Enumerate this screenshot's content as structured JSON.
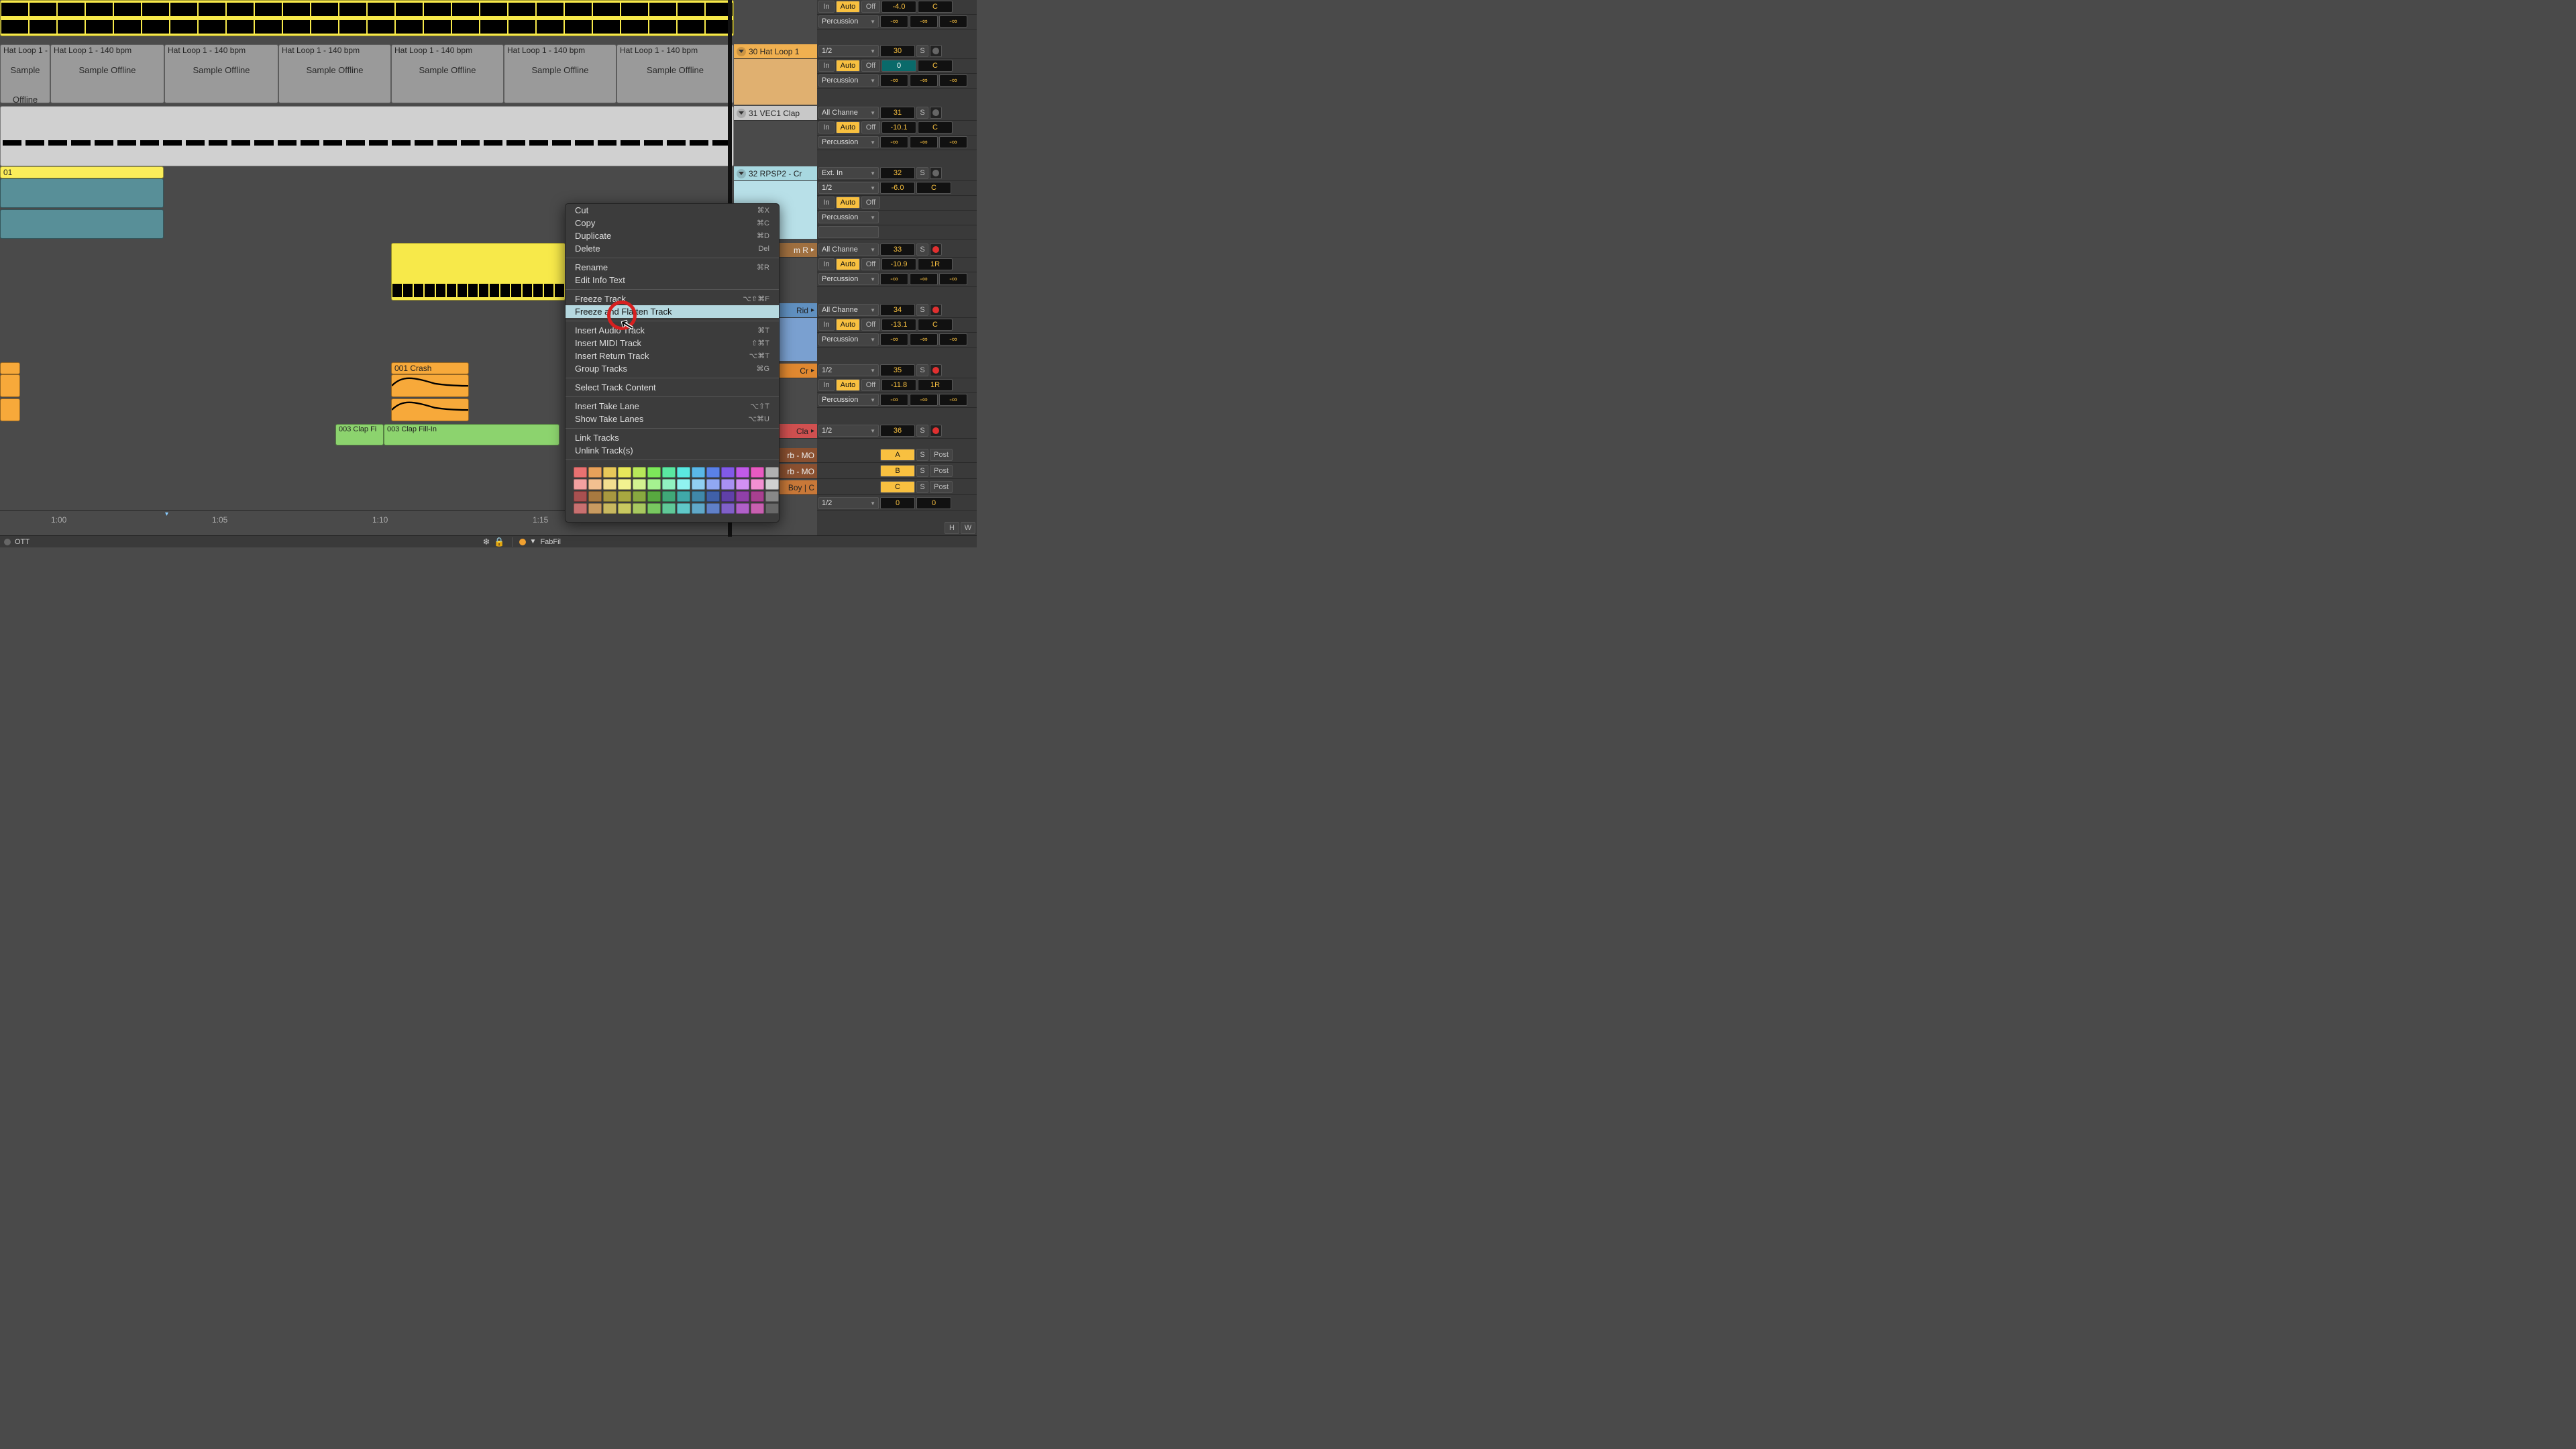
{
  "clips": {
    "hat_loop_label": "Hat Loop 1 - 140 bpm",
    "sample_offline": "Sample Offline",
    "clip_01": "01",
    "crash_001": "001 Crash",
    "clap_fillin_a": "003 Clap Fi",
    "clap_fillin_b": "003 Clap Fill-In"
  },
  "ruler": {
    "t100": "1:00",
    "t105": "1:05",
    "t110": "1:10",
    "t115": "1:15"
  },
  "status": {
    "ott": "OTT",
    "fabfil": "FabFil"
  },
  "tracks": {
    "t30": "30 Hat Loop 1",
    "t31": "31 VEC1 Clap",
    "t32": "32 RPSP2 - Cr",
    "t33_partial": "m R",
    "t34_partial": "Rid",
    "t35_partial": "Cr",
    "t36_partial": "Cla",
    "rb_mo_1": "rb - MO",
    "rb_mo_2": "rb - MO",
    "boy_c": "Boy | C"
  },
  "mixer": {
    "labels": {
      "in": "In",
      "auto": "Auto",
      "off": "Off",
      "percussion": "Percussion",
      "half": "1/2",
      "ext_in": "Ext. In",
      "all_ch": "All Channe",
      "s": "S",
      "post": "Post",
      "h": "H",
      "w": "W"
    },
    "row_a": {
      "vol": "-4.0",
      "pan": "C",
      "inf1": "-∞",
      "inf2": "-∞",
      "inf3": "-∞"
    },
    "row_30": {
      "trk": "30",
      "vol": "0",
      "pan": "C",
      "inf1": "-∞",
      "inf2": "-∞",
      "inf3": "-∞"
    },
    "row_31": {
      "trk": "31",
      "vol": "-10.1",
      "pan": "C",
      "inf1": "-∞",
      "inf2": "-∞",
      "inf3": "-∞"
    },
    "row_32": {
      "trk": "32",
      "vol": "-6.0",
      "pan": "C"
    },
    "row_33": {
      "trk": "33",
      "vol": "-10.9",
      "pan": "1R",
      "inf1": "-∞",
      "inf2": "-∞",
      "inf3": "-∞"
    },
    "row_34": {
      "trk": "34",
      "vol": "-13.1",
      "pan": "C",
      "inf1": "-∞",
      "inf2": "-∞",
      "inf3": "-∞"
    },
    "row_35": {
      "trk": "35",
      "vol": "-11.8",
      "pan": "1R",
      "inf1": "-∞",
      "inf2": "-∞",
      "inf3": "-∞"
    },
    "row_36": {
      "trk": "36"
    },
    "send_a": "A",
    "send_b": "B",
    "send_c": "C",
    "zero": "0"
  },
  "menu": {
    "cut": "Cut",
    "cut_k": "⌘X",
    "copy": "Copy",
    "copy_k": "⌘C",
    "dup": "Duplicate",
    "dup_k": "⌘D",
    "del": "Delete",
    "del_k": "Del",
    "rename": "Rename",
    "rename_k": "⌘R",
    "edit_info": "Edit Info Text",
    "freeze": "Freeze Track",
    "freeze_k": "⌥⇧⌘F",
    "freeze_flat": "Freeze and Flatten Track",
    "ins_audio": "Insert Audio Track",
    "ins_audio_k": "⌘T",
    "ins_midi": "Insert MIDI Track",
    "ins_midi_k": "⇧⌘T",
    "ins_return": "Insert Return Track",
    "ins_return_k": "⌥⌘T",
    "group": "Group Tracks",
    "group_k": "⌘G",
    "select_content": "Select Track Content",
    "ins_take": "Insert Take Lane",
    "ins_take_k": "⌥⇧T",
    "show_take": "Show Take Lanes",
    "show_take_k": "⌥⌘U",
    "link": "Link Tracks",
    "unlink": "Unlink Track(s)"
  },
  "colors": [
    "#e97171",
    "#e8a15a",
    "#e8c85a",
    "#e8e85a",
    "#b8e85a",
    "#7de85a",
    "#5ae8a1",
    "#5ae8e1",
    "#5ab8e8",
    "#5a81e8",
    "#815ae8",
    "#c15ae8",
    "#e85ac1",
    "#b0b0b0",
    "#f2a0a0",
    "#f2c090",
    "#f2de90",
    "#f2f290",
    "#d2f290",
    "#a5f290",
    "#90f2c0",
    "#90f2f0",
    "#90d0f2",
    "#90a8f2",
    "#a890f2",
    "#d290f2",
    "#f290d2",
    "#d0d0d0",
    "#a85050",
    "#a87a40",
    "#a89840",
    "#a8a840",
    "#88a840",
    "#58a840",
    "#40a878",
    "#40a8a8",
    "#4088a8",
    "#4060a8",
    "#6040a8",
    "#9040a8",
    "#a84090",
    "#888888",
    "#c87070",
    "#c89a60",
    "#c8b860",
    "#c8c860",
    "#a8c860",
    "#78c860",
    "#60c898",
    "#60c8c8",
    "#60a8c8",
    "#6080c8",
    "#8060c8",
    "#b060c8",
    "#c860b0",
    "#686868"
  ]
}
